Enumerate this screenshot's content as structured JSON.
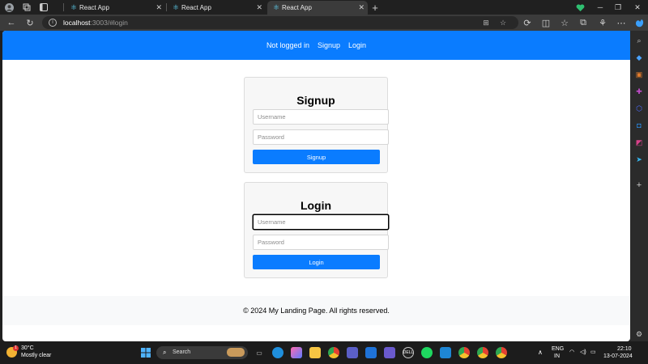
{
  "browser": {
    "tabs": [
      {
        "title": "React App",
        "active": false
      },
      {
        "title": "React App",
        "active": false
      },
      {
        "title": "React App",
        "active": true
      }
    ],
    "new_tab": "+",
    "url_host": "localhost",
    "url_rest": ":3003/#login"
  },
  "nav": {
    "status": "Not logged in",
    "signup": "Signup",
    "login": "Login",
    "color": "#0a7cff"
  },
  "signup_form": {
    "title": "Signup",
    "username_placeholder": "Username",
    "password_placeholder": "Password",
    "button": "Signup"
  },
  "login_form": {
    "title": "Login",
    "username_placeholder": "Username",
    "password_placeholder": "Password",
    "button": "Login"
  },
  "footer": {
    "text": "© 2024 My Landing Page. All rights reserved."
  },
  "taskbar": {
    "temperature": "30°C",
    "condition": "Mostly clear",
    "weather_badge": "1",
    "search_label": "Search",
    "lang_line1": "ENG",
    "lang_line2": "IN",
    "time": "22:10",
    "date": "13-07-2024"
  }
}
